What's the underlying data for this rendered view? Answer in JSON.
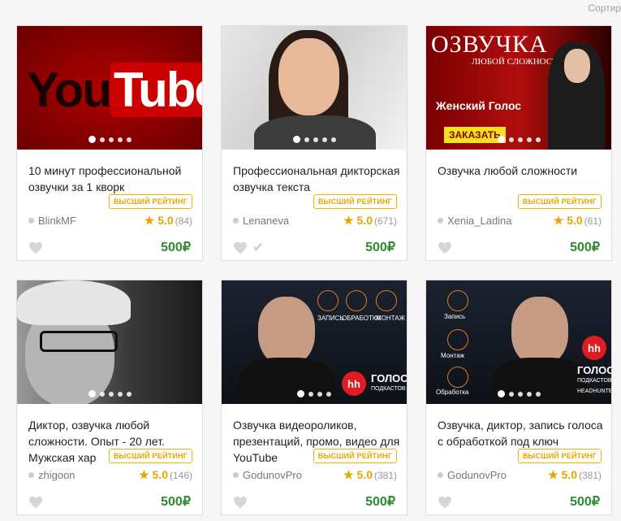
{
  "sort_label": "Сортир",
  "cards": [
    {
      "title": "10 минут профессиональной озвучки за 1 кворк",
      "badge": "ВЫСШИЙ РЕЙТИНГ",
      "seller": "BlinkMF",
      "rating": "5.0",
      "reviews": "(84)",
      "price": "500₽",
      "image_text": {
        "word1": "You",
        "word2": "Tube"
      }
    },
    {
      "title": "Профессиональная дикторская озвучка текста",
      "badge": "ВЫСШИЙ РЕЙТИНГ",
      "seller": "Lenaneva",
      "rating": "5.0",
      "reviews": "(671)",
      "price": "500₽"
    },
    {
      "title": "Озвучка любой сложности",
      "badge": "ВЫСШИЙ РЕЙТИНГ",
      "seller": "Xenia_Ladina",
      "rating": "5.0",
      "reviews": "(61)",
      "price": "500₽",
      "image_text": {
        "heading": "ОЗВУЧКА",
        "sub": "ЛЮБОЙ СЛОЖНОСТИ",
        "voice": "Женский Голос",
        "button": "ЗАКАЗАТЬ"
      }
    },
    {
      "title": "Диктор, озвучка любой сложности. Опыт - 20 лет. Мужская хар",
      "badge": "ВЫСШИЙ РЕЙТИНГ",
      "seller": "zhigoon",
      "rating": "5.0",
      "reviews": "(146)",
      "price": "500₽"
    },
    {
      "title": "Озвучка видеороликов, презентаций, промо, видео для YouTube",
      "badge": "ВЫСШИЙ РЕЙТИНГ",
      "seller": "GodunovPro",
      "rating": "5.0",
      "reviews": "(381)",
      "price": "500₽",
      "image_text": {
        "i1": "ЗАПИСЬ",
        "i2": "ОБРАБОТКА",
        "i3": "МОНТАЖ",
        "hh": "hh",
        "golos": "ГОЛОС",
        "golos_sub": "ПОДКАСТОВ"
      }
    },
    {
      "title": "Озвучка, диктор, запись голоса с обработкой под ключ",
      "badge": "ВЫСШИЙ РЕЙТИНГ",
      "seller": "GodunovPro",
      "rating": "5.0",
      "reviews": "(381)",
      "price": "500₽",
      "image_text": {
        "i1": "Запись",
        "i2": "Монтаж",
        "i3": "Обработка",
        "hh": "hh",
        "golos": "ГОЛОС",
        "golos_sub": "ПОДКАСТОВ",
        "golos_sub2": "HEADHUNTER"
      }
    }
  ]
}
